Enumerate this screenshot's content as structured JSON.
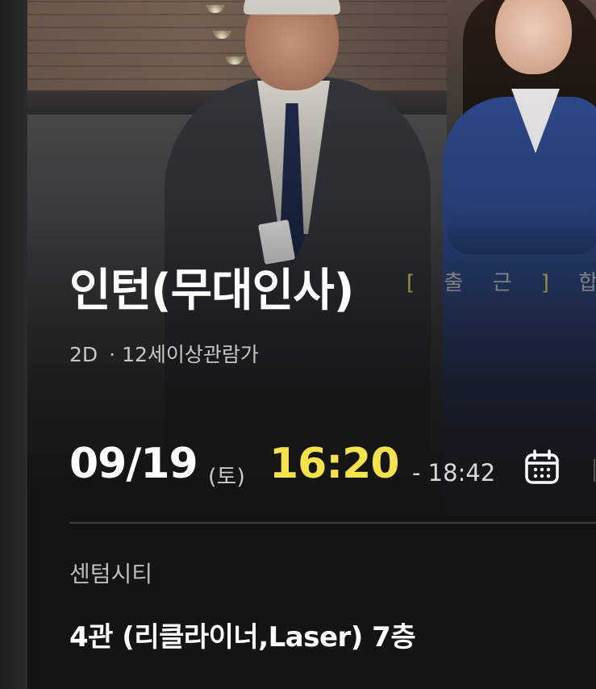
{
  "movie": {
    "title": "인턴(무대인사)",
    "format": "2D",
    "separator": "·",
    "rating": "12세이상관람가"
  },
  "poster": {
    "caption_open": "[",
    "caption_text": "출 근",
    "caption_close": "]",
    "caption_tail": "합"
  },
  "showtime": {
    "date": "09/19",
    "weekday": "(토)",
    "start": "16:20",
    "end": "- 18:42"
  },
  "theater": {
    "name": "센텀시티",
    "screen": "4관 (리클라이너,Laser) 7층"
  },
  "colors": {
    "background": "#141414",
    "accent_time": "#f6e24b",
    "text_primary": "#ffffff",
    "text_secondary": "#c6c6c6"
  },
  "icons": {
    "calendar": "calendar-icon"
  }
}
